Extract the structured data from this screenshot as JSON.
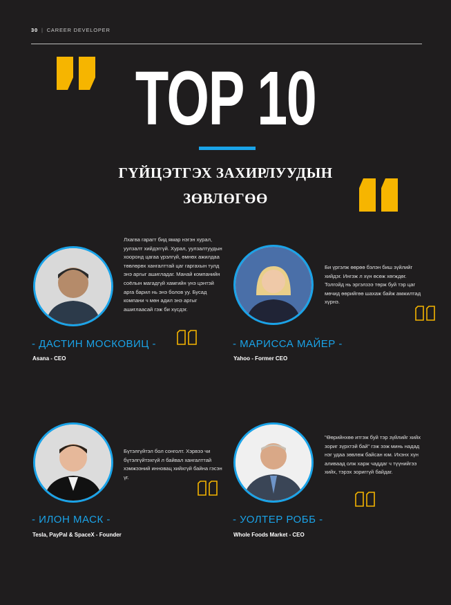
{
  "header": {
    "page_number": "30",
    "separator": "|",
    "section": "CAREER DEVELOPER"
  },
  "title": "TOP 10",
  "subtitle_line1": "ГҮЙЦЭТГЭХ ЗАХИРЛУУДЫН",
  "subtitle_line2": "ЗӨВЛӨГӨӨ",
  "colors": {
    "accent_blue": "#1aa3e8",
    "accent_yellow": "#f6b500",
    "background": "#1f1d1e"
  },
  "profiles": [
    {
      "quote": "Лхагва гарагт бид ямар нэгэн хурал, уулзалт хийдэггүй. Хурал, уулзалтуудын хооронд цагаа үрэлгүй, өмнөх ажилдаа төвлөрөх хангалттай цаг гаргахын тулд энэ аргыг ашигладаг. Манай компанийн соёлын магадгүй хамгийн үнэ цэнтэй арга барил нь энэ болов уу. Бусад компани ч мөн адил энэ аргыг ашиглаасай гэж би хүсдэг.",
      "name": "- ДАСТИН МОСКОВИЦ -",
      "role": "Asana - CEO"
    },
    {
      "quote": "Би үргэлж өөрөө бэлэн биш зүйлийг хийдэг. Ингэж л хүн өсөж хөгждөг. Толгойд нь эргэлзээ төрж буй тэр цаг мөчид өөрийгөө шахаж байж амжилтад хүрнэ.",
      "name": "- МАРИССА МАЙЕР -",
      "role": "Yahoo - Former CEO"
    },
    {
      "quote": "Бүтэлгүйтэл бол сонголт. Хэрвээ чи бүтэлгүйтэхгүй л байвал хангалттай хэмжээний инновац хийхгүй байна гэсэн үг.",
      "name": "- ИЛОН МАСК -",
      "role": "Tesla, PayPal & SpaceX - Founder"
    },
    {
      "quote": "\"Өөрийнхөө итгэж буй тэр зүйлийг хийх зориг зүрхтэй бай\" гэж ээж минь надад нэг удаа зөвлөж байсан юм. Ихэнх хүн аливаад олж харж чаддаг ч түүнийгээ хийх, тэрэх зориггүй байдаг.",
      "name": "- УОЛТЕР РОББ -",
      "role": "Whole Foods Market - CEO"
    }
  ]
}
